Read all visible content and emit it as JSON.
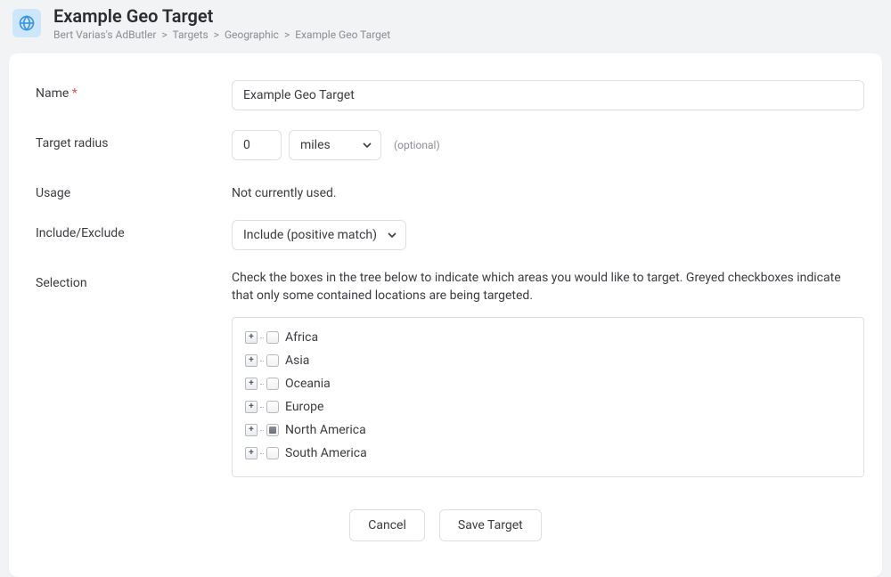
{
  "header": {
    "title": "Example Geo Target",
    "breadcrumb": [
      "Bert Varias's AdButler",
      "Targets",
      "Geographic",
      "Example Geo Target"
    ]
  },
  "form": {
    "name_label": "Name",
    "name_value": "Example Geo Target",
    "radius_label": "Target radius",
    "radius_value": "0",
    "radius_unit": "miles",
    "radius_optional": "(optional)",
    "usage_label": "Usage",
    "usage_value": "Not currently used.",
    "include_label": "Include/Exclude",
    "include_value": "Include (positive match)",
    "selection_label": "Selection",
    "selection_help": "Check the boxes in the tree below to indicate which areas you would like to target.  Greyed checkboxes indicate that only some contained locations are being targeted."
  },
  "tree": [
    {
      "label": "Africa",
      "state": "unchecked"
    },
    {
      "label": "Asia",
      "state": "unchecked"
    },
    {
      "label": "Oceania",
      "state": "unchecked"
    },
    {
      "label": "Europe",
      "state": "unchecked"
    },
    {
      "label": "North America",
      "state": "partial"
    },
    {
      "label": "South America",
      "state": "unchecked"
    }
  ],
  "buttons": {
    "cancel": "Cancel",
    "save": "Save Target"
  }
}
